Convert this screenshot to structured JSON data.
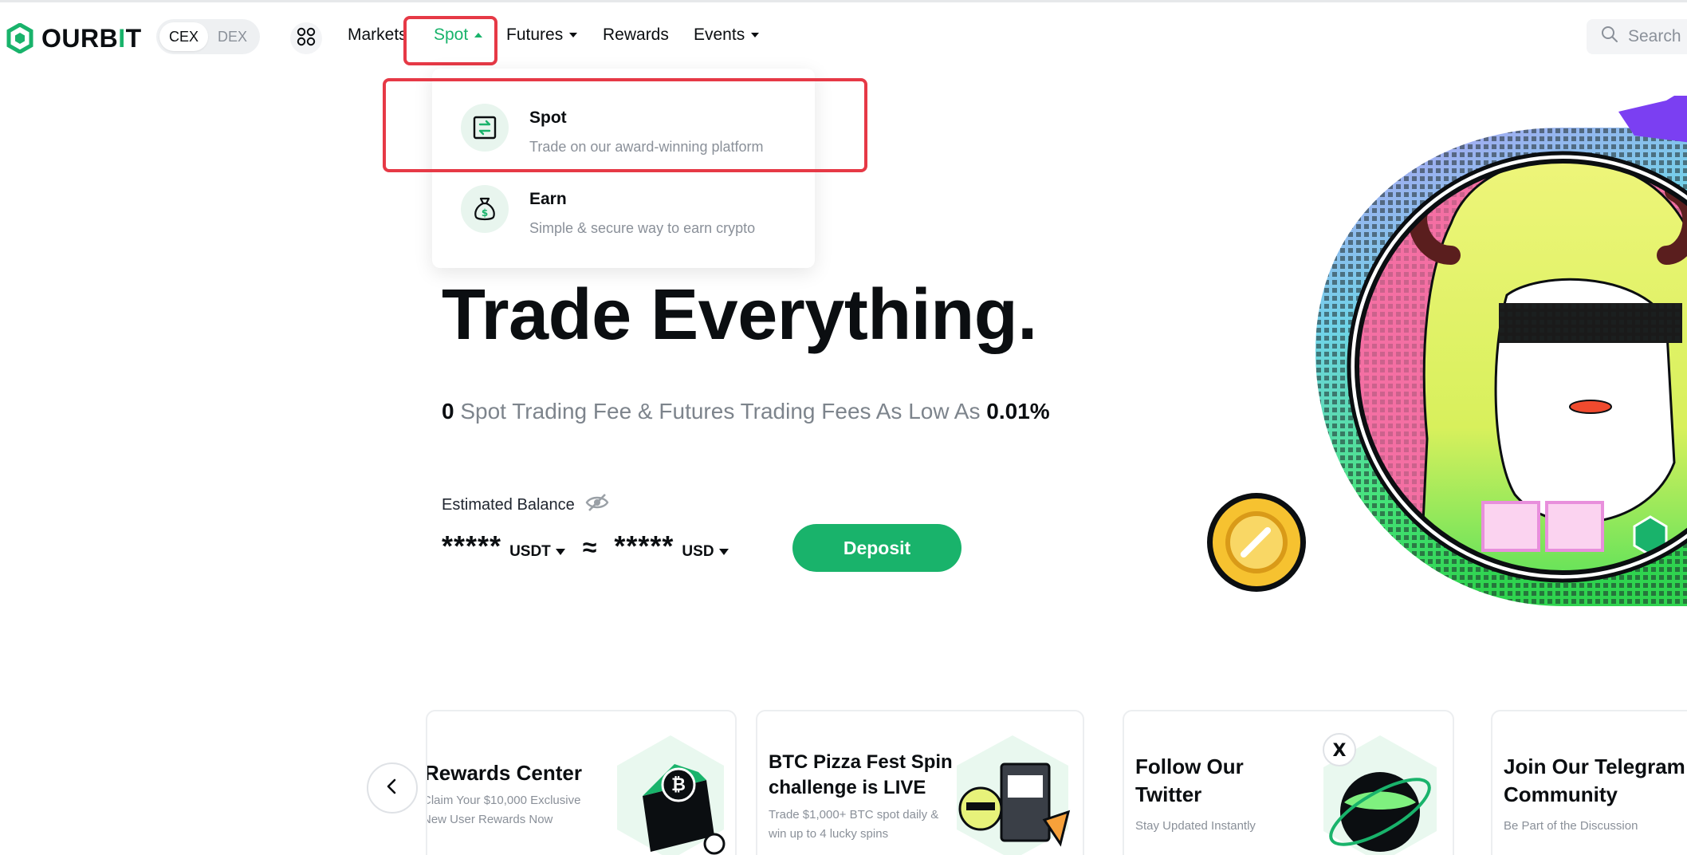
{
  "brand": {
    "name_prefix": "OURB",
    "name_accent": "I",
    "name_suffix": "T",
    "accent_color": "#19b36b"
  },
  "exchange_toggle": {
    "options": [
      "CEX",
      "DEX"
    ],
    "selected": "CEX"
  },
  "nav": {
    "apps_icon": "grid-icon",
    "items": [
      {
        "label": "Markets"
      },
      {
        "label": "Spot",
        "open": true
      },
      {
        "label": "Futures"
      },
      {
        "label": "Rewards"
      },
      {
        "label": "Events"
      }
    ]
  },
  "search": {
    "placeholder": "Search"
  },
  "spot_dropdown": {
    "items": [
      {
        "title": "Spot",
        "desc": "Trade on our award-winning platform",
        "icon": "swap-icon"
      },
      {
        "title": "Earn",
        "desc": "Simple & secure way to earn crypto",
        "icon": "money-bag-icon"
      }
    ]
  },
  "hero": {
    "title": "Trade Everything.",
    "sub_zero": "0",
    "sub_text": " Spot Trading Fee & Futures Trading Fees As Low As ",
    "sub_rate": "0.01%",
    "balance_label": "Estimated Balance",
    "balance_primary": "*****",
    "balance_primary_unit": "USDT",
    "approx": "≈",
    "balance_secondary": "*****",
    "balance_secondary_unit": "USD",
    "deposit_label": "Deposit"
  },
  "cards": [
    {
      "title": "Rewards Center",
      "desc_line1": "Claim Your $10,000 Exclusive",
      "desc_line2": "New User Rewards Now"
    },
    {
      "title_line1": "BTC Pizza Fest Spin",
      "title_line2": "challenge is LIVE",
      "desc_line1": "Trade $1,000+ BTC spot daily &",
      "desc_line2": "win up to 4 lucky spins"
    },
    {
      "title_line1": "Follow Our",
      "title_line2": "Twitter",
      "desc_line1": "Stay Updated Instantly"
    },
    {
      "title_line1": "Join Our Telegram",
      "title_line2": "Community",
      "desc_line1": "Be Part of the Discussion"
    }
  ],
  "colors": {
    "primary": "#19b36b",
    "highlight": "#e63946",
    "text": "#0b0e11",
    "muted": "#8a9099"
  }
}
